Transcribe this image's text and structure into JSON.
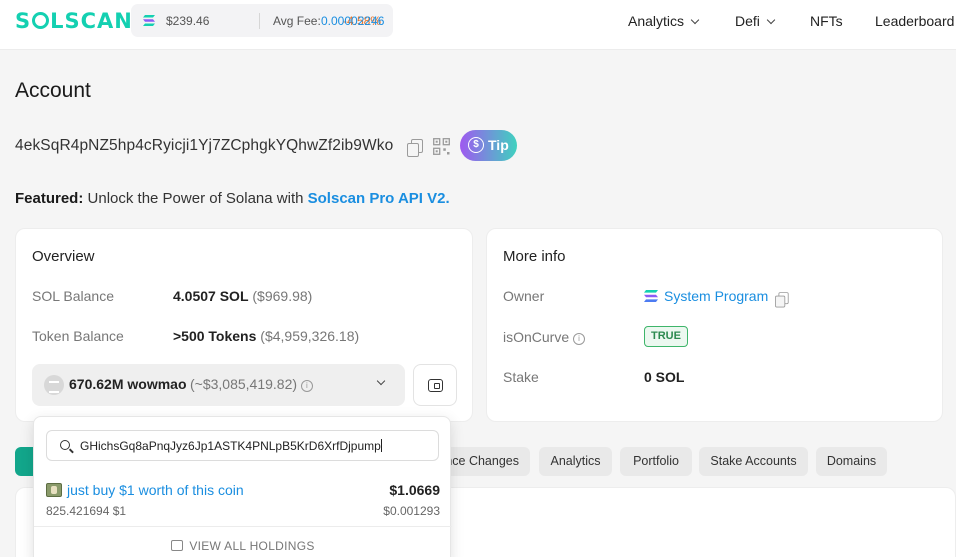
{
  "header": {
    "logo": "SOLSCAN",
    "sol_price": "$239.46",
    "sol_change": "-4.58%",
    "avg_fee_label": "Avg Fee:",
    "avg_fee_value": "0.00002246",
    "nav": [
      {
        "label": "Analytics",
        "dropdown": true
      },
      {
        "label": "Defi",
        "dropdown": true
      },
      {
        "label": "NFTs",
        "dropdown": false
      },
      {
        "label": "Leaderboard",
        "dropdown": false
      }
    ]
  },
  "page": {
    "title": "Account",
    "address": "4ekSqR4pNZ5hp4cRyicji1Yj7ZCphgkYQhwZf2ib9Wko",
    "tip_label": "Tip",
    "featured_label": "Featured:",
    "featured_text": "Unlock the Power of Solana with",
    "featured_link": "Solscan Pro API V2."
  },
  "overview": {
    "title": "Overview",
    "sol_balance_label": "SOL Balance",
    "sol_balance_value": "4.0507 SOL",
    "sol_balance_usd": "($969.98)",
    "token_balance_label": "Token Balance",
    "token_balance_value": ">500 Tokens",
    "token_balance_usd": "($4,959,326.18)",
    "selected_holding_amount": "670.62M wowmao",
    "selected_holding_usd": "(~$3,085,419.82)"
  },
  "more_info": {
    "title": "More info",
    "owner_label": "Owner",
    "owner_value": "System Program",
    "oncurve_label": "isOnCurve",
    "oncurve_value": "TRUE",
    "stake_label": "Stake",
    "stake_value": "0 SOL"
  },
  "tabs": [
    "nce Changes",
    "Analytics",
    "Portfolio",
    "Stake Accounts",
    "Domains"
  ],
  "dropdown": {
    "search_value": "GHichsGq8aPnqJyz6Jp1ASTK4PNLpB5KrD6XrfDjpump",
    "result": {
      "name": "just buy $1 worth of this coin",
      "price": "$1.0669",
      "quantity": "825.421694 $1",
      "unit_price": "$0.001293"
    },
    "view_all_label": "VIEW ALL HOLDINGS"
  },
  "colors": {
    "brand": "#14d0b1",
    "link": "#1a8ee0",
    "negative": "#e8742b",
    "true_badge": "#3eb56a"
  }
}
